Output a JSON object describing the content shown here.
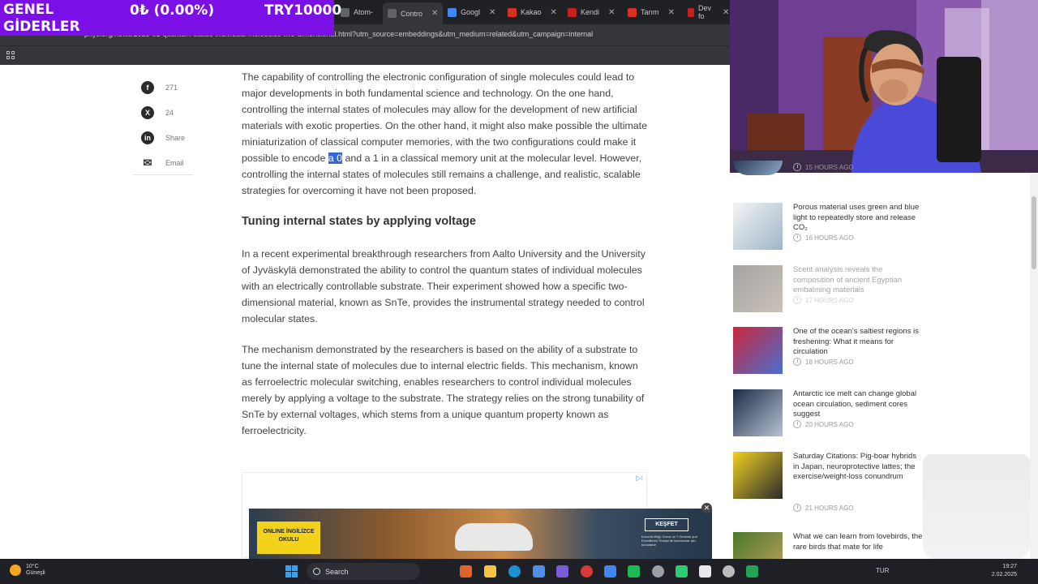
{
  "overlay": {
    "title_line1": "GENEL",
    "title_line2": "GİDERLER",
    "change": "0₺ (0.00%)",
    "amount": "TRY10000"
  },
  "tabs": [
    {
      "label": "Atom-",
      "icon": "page-icon",
      "color": "#5f6368"
    },
    {
      "label": "Contro",
      "icon": "page-icon",
      "color": "#5f6368",
      "active": true
    },
    {
      "label": "Googl",
      "icon": "google-icon",
      "color": "#4285f4"
    },
    {
      "label": "Kakao",
      "icon": "n-icon",
      "color": "#d93025"
    },
    {
      "label": "Kendi",
      "icon": "page-icon",
      "color": "#c5221f"
    },
    {
      "label": "Tarım",
      "icon": "d-icon",
      "color": "#d93025"
    },
    {
      "label": "Dev fo",
      "icon": "page-icon",
      "color": "#c5221f"
    }
  ],
  "url": "phys.org/news/2025-01-quantum-states-individual-molecules-two-dimensional.html?utm_source=embeddings&utm_medium=related&utm_campaign=internal",
  "share": [
    {
      "icon": "facebook-icon",
      "glyph": "f",
      "label": "271"
    },
    {
      "icon": "x-icon",
      "glyph": "X",
      "label": "24"
    },
    {
      "icon": "linkedin-icon",
      "glyph": "in",
      "label": "Share"
    },
    {
      "icon": "email-icon",
      "glyph": "✉",
      "label": "Email"
    }
  ],
  "article": {
    "p1_before": "The capability of controlling the electronic configuration of single molecules could lead to major developments in both fundamental science and technology. On the one hand, controlling the internal states of molecules may allow for the development of new artificial materials with exotic properties. On the other hand, it might also make possible the ultimate miniaturization of classical computer memories, with the two configurations could make it possible to encode ",
    "p1_highlight": "a 0",
    "p1_after": " and a 1 in a classical memory unit at the molecular level. However, controlling the internal states of molecules still remains a challenge, and realistic, scalable strategies for overcoming it have not been proposed.",
    "heading": "Tuning internal states by applying voltage",
    "p2": "In a recent experimental breakthrough researchers from Aalto University and the University of Jyväskylä demonstrated the ability to control the quantum states of individual molecules with an electrically controllable substrate. Their experiment showed how a specific two-dimensional material, known as SnTe, provides the instrumental strategy needed to control molecular states.",
    "p3": "The mechanism demonstrated by the researchers is based on the ability of a substrate to tune the internal state of molecules due to internal electric fields. This mechanism, known as ferroelectric molecular switching, enables researchers to control individual molecules merely by applying a voltage to the substrate. The strategy relies on the strong tunability of SnTe by external voltages, which stems from a unique quantum property known as ferroelectricity."
  },
  "ad": {
    "badge": "ONLINE İNGİLİZCE OKULU",
    "cta": "KEŞFET",
    "fine": "Kurumlu Bilgi, Doruk ve T Genesin yurt Ezerdilerini Türkiye'de katılımcılar için kurdulardr"
  },
  "news": [
    {
      "title": "",
      "time": "15 HOURS AGO",
      "thumb": [
        "#2a3a5a",
        "#8fa8c8"
      ],
      "faded": false
    },
    {
      "title": "Porous material uses green and blue light to repeatedly store and release CO₂",
      "time": "16 HOURS AGO",
      "thumb": [
        "#f4f4f4",
        "#9fb6c8"
      ],
      "faded": false
    },
    {
      "title": "Scent analysis reveals the composition of ancient Egyptian embalming materials",
      "time": "17 HOURS AGO",
      "thumb": [
        "#3a3530",
        "#8a7a66"
      ],
      "faded": true
    },
    {
      "title": "One of the ocean's saltiest regions is freshening: What it means for circulation",
      "time": "18 HOURS AGO",
      "thumb": [
        "#c8283a",
        "#4a6fd0"
      ],
      "faded": false
    },
    {
      "title": "Antarctic ice melt can change global ocean circulation, sediment cores suggest",
      "time": "20 HOURS AGO",
      "thumb": [
        "#1c2a44",
        "#b8c4d6"
      ],
      "faded": false
    },
    {
      "title": "Saturday Citations: Pig-boar hybrids in Japan, neuroprotective lattes; the exercise/weight-loss conundrum",
      "time": "21 HOURS AGO",
      "thumb": [
        "#f2d020",
        "#2a2a2a"
      ],
      "faded": false
    },
    {
      "title": "What we can learn from lovebirds, the rare birds that mate for life",
      "time": "",
      "thumb": [
        "#4a7a2a",
        "#c0a060"
      ],
      "faded": false
    }
  ],
  "taskbar": {
    "temp": "10°C",
    "condition": "Güneşli",
    "search_label": "Search",
    "apps": [
      "#e0622d",
      "#f5c542",
      "#1e8fd6",
      "#4c8ee8",
      "#7b5cd6",
      "#d83a3a",
      "#4285f4",
      "#1db954",
      "#9aa0a6",
      "#2ecc71",
      "#e8e8e8",
      "#bbbbbb",
      "#23a455"
    ],
    "lang": "TUR",
    "time": "19:27",
    "date": "2.02.2025"
  },
  "colors": {
    "overlay": "#7a0fe6",
    "highlight": "#2f6ad8",
    "chrome": "#35363a"
  }
}
